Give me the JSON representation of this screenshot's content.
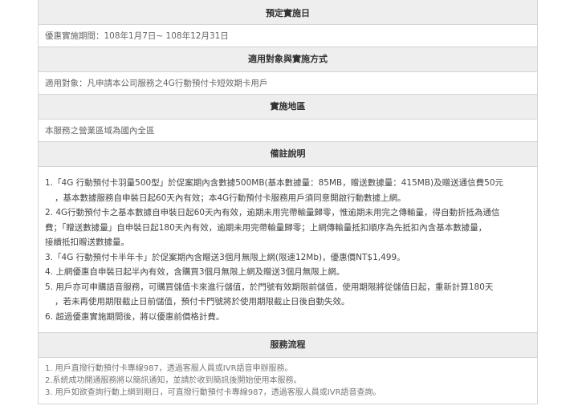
{
  "sections": [
    {
      "header": "預定實施日",
      "content": "優惠實施期間：108年1月7日~ 108年12月31日"
    },
    {
      "header": "適用對象與實施方式",
      "content": "適用對象：凡申請本公司服務之4G行動預付卡短效期卡用戶"
    },
    {
      "header": "實施地區",
      "content": "本服務之營業區域為國內全區"
    }
  ],
  "notes": {
    "header": "備註說明",
    "items": [
      [
        "1.「4G 行動預付卡羽量500型」於促案期內含數據500MB(基本數據量：85MB，贈送數據量：415MB)及贈送通信費50元",
        "，基本數據服務自申裝日起60天內有效；本4G行動預付卡服務用戶須同意開啟行動數據上網。"
      ],
      [
        "2. 4G行動預付卡之基本數據自申裝日起60天內有效，逾期未用完帶輸量歸零，惟逾期未用完之傳輸量，得自動折抵為通信",
        "費；「贈送數據量」自申裝日起180天內有效，逾期未用完帶輸量歸零；上網傳輸量抵扣順序為先抵扣內含基本數據量，",
        "接續抵扣贈送數據量。"
      ],
      [
        "3.「4G 行動預付卡半年卡」於促案期內含贈送3個月無限上網(限速12Mb)，優惠價NT$1,499。"
      ],
      [
        "4. 上網優惠自申裝日起半內有效，含購買3個月無限上網及贈送3個月無限上網。"
      ],
      [
        "5. 用戶亦可申購語音服務，可購買儲值卡來進行儲值，於門號有效期限前儲值，使用期限將從儲值日起，重新計算180天",
        "，若未再使用期限截止日前儲值，預付卡門號將於使用期限截止日後自動失效。"
      ],
      [
        "6. 超過優惠實施期間後，將以優惠前價格計費。"
      ]
    ]
  },
  "flow": {
    "header": "服務流程",
    "items": [
      "1. 用戶直撥行動預付卡專線987，透過客服人員或IVR語音申辦服務。",
      "2.系統成功開通服務將以簡訊通知，並請於收到簡訊後開始使用本服務。",
      "3. 用戶如欲查詢行動上網到期日，可直撥行動預付卡專線987，透過客服人員或IVR語音查詢。"
    ]
  }
}
